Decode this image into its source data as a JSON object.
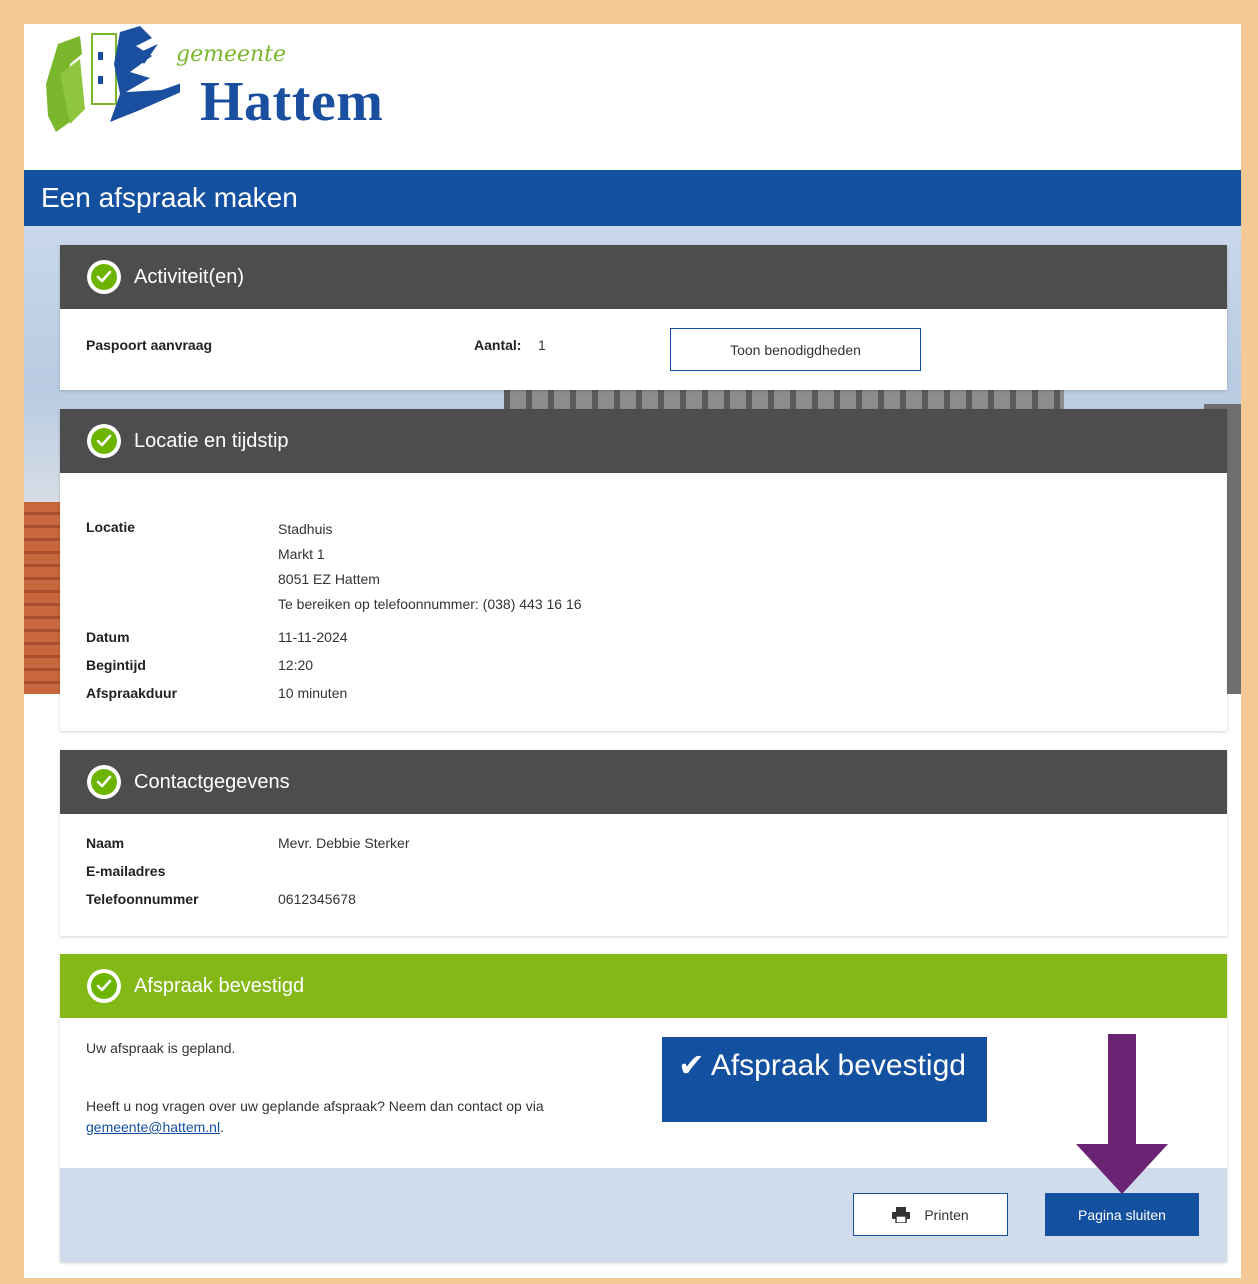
{
  "logo": {
    "small_text": "gemeente",
    "big_text": "Hattem"
  },
  "page_title": "Een afspraak maken",
  "activities": {
    "heading": "Activiteit(en)",
    "item_label": "Paspoort aanvraag",
    "count_label": "Aantal:",
    "count_value": "1",
    "requirements_button": "Toon benodigdheden"
  },
  "location": {
    "heading": "Locatie en tijdstip",
    "location_label": "Locatie",
    "address_lines": [
      "Stadhuis",
      "Markt 1",
      "8051 EZ Hattem",
      "Te bereiken op telefoonnummer: (038) 443 16 16"
    ],
    "date_label": "Datum",
    "date_value": "11-11-2024",
    "start_label": "Begintijd",
    "start_value": "12:20",
    "duration_label": "Afspraakduur",
    "duration_value": "10 minuten"
  },
  "contact": {
    "heading": "Contactgegevens",
    "name_label": "Naam",
    "name_value": "Mevr. Debbie Sterker",
    "email_label": "E-mailadres",
    "email_value": "",
    "phone_label": "Telefoonnummer",
    "phone_value": "0612345678"
  },
  "confirmation": {
    "heading": "Afspraak bevestigd",
    "planned_text": "Uw afspraak is gepland.",
    "questions_text": "Heeft u nog vragen over uw geplande afspraak? Neem dan contact op via",
    "email_link": "gemeente@hattem.nl",
    "email_suffix": ".",
    "badge_text": "Afspraak bevestigd",
    "print_button": "Printen",
    "close_button": "Pagina sluiten"
  },
  "colors": {
    "brand_blue": "#1450a0",
    "header_gray": "#4d4d4d",
    "success_green": "#84b817",
    "arrow_purple": "#6b2473",
    "frame_orange": "#f5c995"
  },
  "icons": {
    "section_status": "check-circle-icon",
    "print": "printer-icon",
    "badge": "checkmark-icon"
  }
}
